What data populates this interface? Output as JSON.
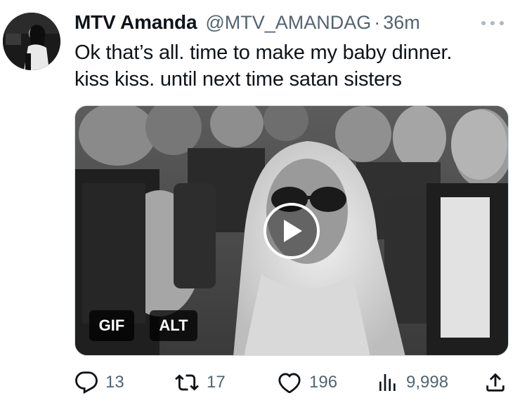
{
  "tweet": {
    "author_name": "MTV Amanda",
    "handle": "@MTV_AMANDAG",
    "separator": "·",
    "time": "36m",
    "text_line1": "Ok that’s all. time to make my baby dinner.",
    "text_line2": "kiss kiss. until next time satan sisters"
  },
  "media": {
    "gif_badge": "GIF",
    "alt_badge": "ALT"
  },
  "actions": {
    "replies": "13",
    "reposts": "17",
    "likes": "196",
    "views": "9,998"
  },
  "icons": {
    "more": "more-icon",
    "reply": "reply-icon",
    "repost": "repost-icon",
    "like": "heart-icon",
    "views": "views-icon",
    "share": "share-icon"
  },
  "colors": {
    "text": "#0f1419",
    "muted": "#536471"
  }
}
